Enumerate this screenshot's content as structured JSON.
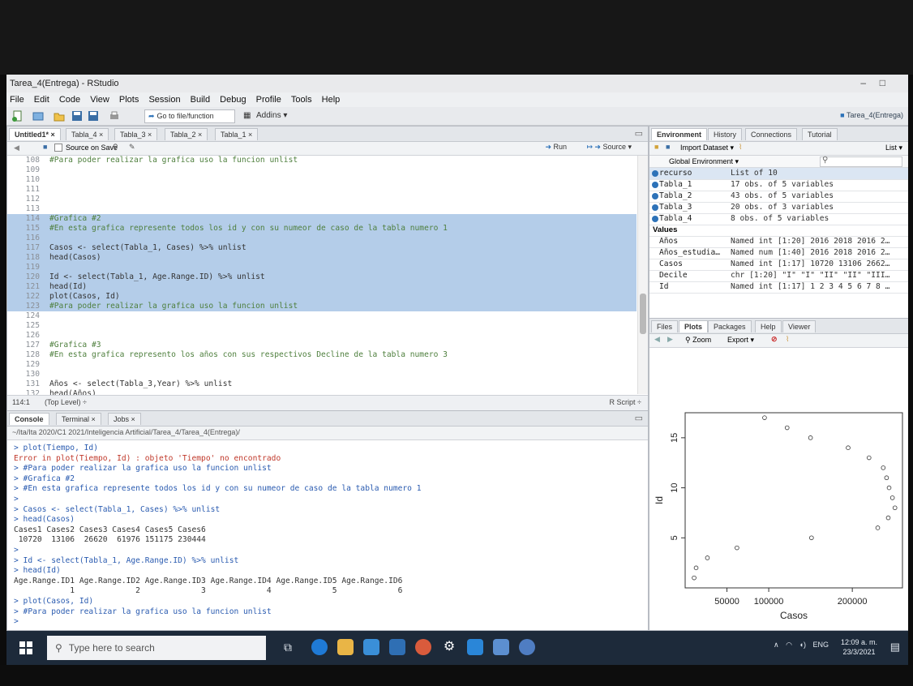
{
  "window": {
    "title": "Tarea_4(Entrega) - RStudio",
    "min": "–",
    "max": "□"
  },
  "menu": [
    "File",
    "Edit",
    "Code",
    "View",
    "Plots",
    "Session",
    "Build",
    "Debug",
    "Profile",
    "Tools",
    "Help"
  ],
  "toolbar": {
    "goto": "Go to file/function",
    "addins": "Addins ▾",
    "project": "Tarea_4(Entrega)"
  },
  "editor": {
    "tabs": [
      "Untitled1* ×",
      "Tabla_4 ×",
      "Tabla_3 ×",
      "Tabla_2 ×",
      "Tabla_1 ×"
    ],
    "source_on_save": "Source on Save",
    "run": "Run",
    "source": "Source ▾",
    "lines": [
      {
        "n": "108",
        "t": "#Para poder realizar la grafica uso la funcion unlist",
        "sel": false,
        "cmt": true
      },
      {
        "n": "109",
        "t": "",
        "sel": false,
        "cmt": false
      },
      {
        "n": "110",
        "t": "",
        "sel": false,
        "cmt": false
      },
      {
        "n": "111",
        "t": "",
        "sel": false,
        "cmt": false
      },
      {
        "n": "112",
        "t": "",
        "sel": false,
        "cmt": false
      },
      {
        "n": "113",
        "t": "",
        "sel": false,
        "cmt": false
      },
      {
        "n": "114",
        "t": "#Grafica #2",
        "sel": true,
        "cmt": true
      },
      {
        "n": "115",
        "t": "#En esta grafica represente todos los id y con su numeor de caso de la tabla numero 1",
        "sel": true,
        "cmt": true
      },
      {
        "n": "116",
        "t": "",
        "sel": true,
        "cmt": false
      },
      {
        "n": "117",
        "t": "Casos <- select(Tabla_1, Cases) %>% unlist",
        "sel": true,
        "cmt": false
      },
      {
        "n": "118",
        "t": "head(Casos)",
        "sel": true,
        "cmt": false
      },
      {
        "n": "119",
        "t": "",
        "sel": true,
        "cmt": false
      },
      {
        "n": "120",
        "t": "Id <- select(Tabla_1, Age.Range.ID) %>% unlist",
        "sel": true,
        "cmt": false
      },
      {
        "n": "121",
        "t": "head(Id)",
        "sel": true,
        "cmt": false
      },
      {
        "n": "122",
        "t": "plot(Casos, Id)",
        "sel": true,
        "cmt": false
      },
      {
        "n": "123",
        "t": "#Para poder realizar la grafica uso la funcion unlist",
        "sel": true,
        "cmt": true
      },
      {
        "n": "124",
        "t": "",
        "sel": false,
        "cmt": false
      },
      {
        "n": "125",
        "t": "",
        "sel": false,
        "cmt": false
      },
      {
        "n": "126",
        "t": "",
        "sel": false,
        "cmt": false
      },
      {
        "n": "127",
        "t": "#Grafica #3",
        "sel": false,
        "cmt": true
      },
      {
        "n": "128",
        "t": "#En esta grafica represento los años con sus respectivos Decline de la tabla numero 3",
        "sel": false,
        "cmt": true
      },
      {
        "n": "129",
        "t": "",
        "sel": false,
        "cmt": false
      },
      {
        "n": "130",
        "t": "",
        "sel": false,
        "cmt": false
      },
      {
        "n": "131",
        "t": "Años <- select(Tabla_3,Year) %>% unlist",
        "sel": false,
        "cmt": false
      },
      {
        "n": "132",
        "t": "head(Años)",
        "sel": false,
        "cmt": false
      },
      {
        "n": "133",
        "t": "",
        "sel": false,
        "cmt": false
      }
    ],
    "status_pos": "114:1",
    "status_scope": "(Top Level) ÷",
    "status_type": "R Script ÷"
  },
  "console": {
    "tabs": [
      "Console",
      "Terminal ×",
      "Jobs ×"
    ],
    "path": "~/Ita/Ita 2020/C1 2021/Inteligencia Artificial/Tarea_4/Tarea_4(Entrega)/",
    "lines": [
      {
        "t": "> plot(Tiempo, Id)",
        "k": "prompt"
      },
      {
        "t": "Error in plot(Tiempo, Id) : objeto 'Tiempo' no encontrado",
        "k": "err"
      },
      {
        "t": "> #Para poder realizar la grafica uso la funcion unlist",
        "k": "prompt"
      },
      {
        "t": "> #Grafica #2",
        "k": "prompt"
      },
      {
        "t": "> #En esta grafica represente todos los id y con su numeor de caso de la tabla numero 1",
        "k": "prompt"
      },
      {
        "t": ">",
        "k": "prompt"
      },
      {
        "t": "> Casos <- select(Tabla_1, Cases) %>% unlist",
        "k": "prompt"
      },
      {
        "t": "> head(Casos)",
        "k": "prompt"
      },
      {
        "t": "Cases1 Cases2 Cases3 Cases4 Cases5 Cases6",
        "k": "out"
      },
      {
        "t": " 10720  13106  26620  61976 151175 230444",
        "k": "out"
      },
      {
        "t": ">",
        "k": "prompt"
      },
      {
        "t": "> Id <- select(Tabla_1, Age.Range.ID) %>% unlist",
        "k": "prompt"
      },
      {
        "t": "> head(Id)",
        "k": "prompt"
      },
      {
        "t": "Age.Range.ID1 Age.Range.ID2 Age.Range.ID3 Age.Range.ID4 Age.Range.ID5 Age.Range.ID6",
        "k": "out"
      },
      {
        "t": "            1             2             3             4             5             6",
        "k": "out"
      },
      {
        "t": "> plot(Casos, Id)",
        "k": "prompt"
      },
      {
        "t": "> #Para poder realizar la grafica uso la funcion unlist",
        "k": "prompt"
      },
      {
        "t": ">",
        "k": "prompt"
      }
    ]
  },
  "environment": {
    "tabs": [
      "Environment",
      "History",
      "Connections",
      "Tutorial"
    ],
    "import": "Import Dataset ▾",
    "list": "List ▾",
    "scope": "Global Environment ▾",
    "data_rows": [
      {
        "name": "recurso",
        "value": "List of 10"
      },
      {
        "name": "Tabla_1",
        "value": "17 obs. of 5 variables"
      },
      {
        "name": "Tabla_2",
        "value": "43 obs. of 5 variables"
      },
      {
        "name": "Tabla_3",
        "value": "20 obs. of 3 variables"
      },
      {
        "name": "Tabla_4",
        "value": "8 obs. of 5 variables"
      }
    ],
    "values_header": "Values",
    "value_rows": [
      {
        "name": "Años",
        "value": "Named int [1:20] 2016 2018 2016 2…"
      },
      {
        "name": "Años_estudia…",
        "value": "Named num [1:40] 2016 2018 2016 2…"
      },
      {
        "name": "Casos",
        "value": "Named int [1:17] 10720 13106 2662…"
      },
      {
        "name": "Decile",
        "value": "chr [1:20] \"I\" \"I\" \"II\" \"II\" \"III…"
      },
      {
        "name": "Id",
        "value": "Named int [1:17] 1 2 3 4 5 6 7 8 …"
      }
    ]
  },
  "plots": {
    "tabs": [
      "Files",
      "Plots",
      "Packages",
      "Help",
      "Viewer"
    ],
    "zoom": "Zoom",
    "export": "Export ▾"
  },
  "chart_data": {
    "type": "scatter",
    "xlabel": "Casos",
    "ylabel": "Id",
    "xlim": [
      0,
      260000
    ],
    "ylim": [
      0,
      17.5
    ],
    "xticks": [
      50000,
      100000,
      200000
    ],
    "xtick_labels": [
      "50000",
      "100000",
      "200000"
    ],
    "yticks": [
      5,
      10,
      15
    ],
    "ytick_labels": [
      "5",
      "10",
      "15"
    ],
    "x": [
      10720,
      13106,
      26620,
      61976,
      151175,
      230444,
      243000,
      251000,
      248000,
      244000,
      241000,
      237000,
      220000,
      195000,
      150000,
      122000,
      95000
    ],
    "y": [
      1,
      2,
      3,
      4,
      5,
      6,
      7,
      8,
      9,
      10,
      11,
      12,
      13,
      14,
      15,
      16,
      17
    ]
  },
  "taskbar": {
    "search": "Type here to search",
    "lang": "ENG",
    "time": "12:09 a. m.",
    "date": "23/3/2021"
  }
}
